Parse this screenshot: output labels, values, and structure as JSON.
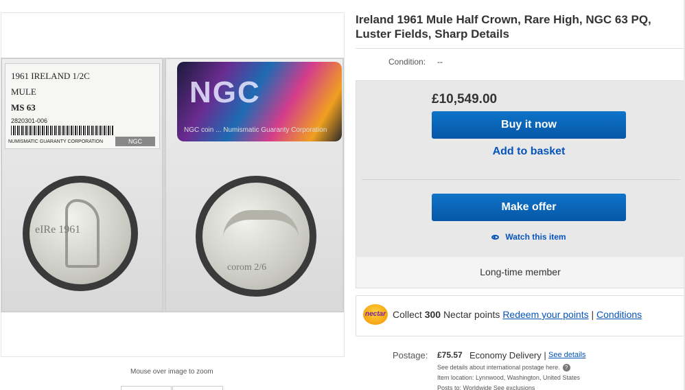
{
  "listing": {
    "title": "Ireland 1961 Mule Half Crown, Rare High, NGC 63 PQ, Luster Fields, Sharp Details",
    "condition_label": "Condition:",
    "condition_value": "--"
  },
  "image": {
    "slab_label": {
      "line1": "1961 IRELAND 1/2C",
      "line2": "MULE",
      "grade": "MS 63",
      "cert": "2820301-006",
      "company": "NUMISMATIC GUARANTY CORPORATION",
      "mini_logo": "NGC"
    },
    "hologram_logo": "NGC",
    "hologram_sub": "NGC coin ... Numismatic Guaranty Corporation",
    "coin_left_text": "eIRe  1961",
    "coin_right_text": "corom  2/6",
    "zoom_hint": "Mouse over image to zoom"
  },
  "buy_box": {
    "price": "£10,549.00",
    "buy_now": "Buy it now",
    "add_to_basket": "Add to basket",
    "make_offer": "Make offer",
    "watch": "Watch this item",
    "member": "Long-time member"
  },
  "nectar": {
    "logo": "nectar",
    "collect": "Collect",
    "points": "300",
    "points_suffix": "Nectar points",
    "redeem": "Redeem your points",
    "separator": "|",
    "conditions": "Conditions"
  },
  "postage": {
    "label": "Postage:",
    "amount": "£75.57",
    "method": "Economy Delivery |",
    "see_details": "See details",
    "intl_note": "See details about international postage here.",
    "help_icon": "?",
    "location": "Item location:  Lynnwood, Washington, United States",
    "posts_to": "Posts to:  Worldwide   See exclusions"
  },
  "colors": {
    "primary_button": "#0656a6",
    "link": "#0654ba",
    "buy_box_bg": "#e8e8e8",
    "nectar_orange": "#f29100"
  }
}
